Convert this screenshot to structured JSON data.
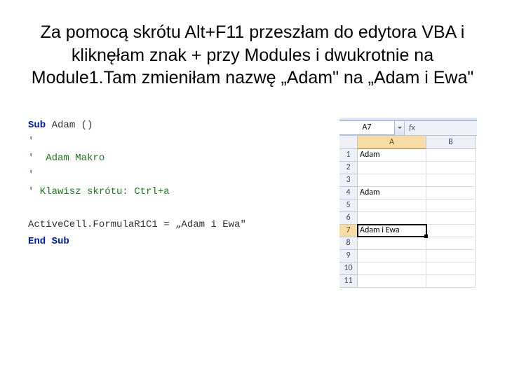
{
  "title": "Za pomocą skrótu Alt+F11 przeszłam do edytora VBA i kliknęłam znak + przy Modules i dwukrotnie na Module1.Tam zmieniłam nazwę „Adam\" na „Adam i Ewa\"",
  "code": {
    "l1_kw": "Sub",
    "l1_rest": " Adam ()",
    "l2": "'",
    "l3": "'  Adam Makro",
    "l4": "'",
    "l5": "' Klawisz skrótu: Ctrl+a",
    "l6": "",
    "l7": "ActiveCell.FormulaR1C1 = „Adam i Ewa\"",
    "l8_kw": "End Sub"
  },
  "excel": {
    "namebox": "A7",
    "fx": "fx",
    "columns": [
      "A",
      "B"
    ],
    "selected_col_idx": 0,
    "selected_row": 7,
    "rows": [
      {
        "n": "1",
        "a": "Adam",
        "b": ""
      },
      {
        "n": "2",
        "a": "",
        "b": ""
      },
      {
        "n": "3",
        "a": "",
        "b": ""
      },
      {
        "n": "4",
        "a": "Adam",
        "b": ""
      },
      {
        "n": "5",
        "a": "",
        "b": ""
      },
      {
        "n": "6",
        "a": "",
        "b": ""
      },
      {
        "n": "7",
        "a": "Adam i Ewa",
        "b": ""
      },
      {
        "n": "8",
        "a": "",
        "b": ""
      },
      {
        "n": "9",
        "a": "",
        "b": ""
      },
      {
        "n": "10",
        "a": "",
        "b": ""
      },
      {
        "n": "11",
        "a": "",
        "b": ""
      }
    ]
  }
}
